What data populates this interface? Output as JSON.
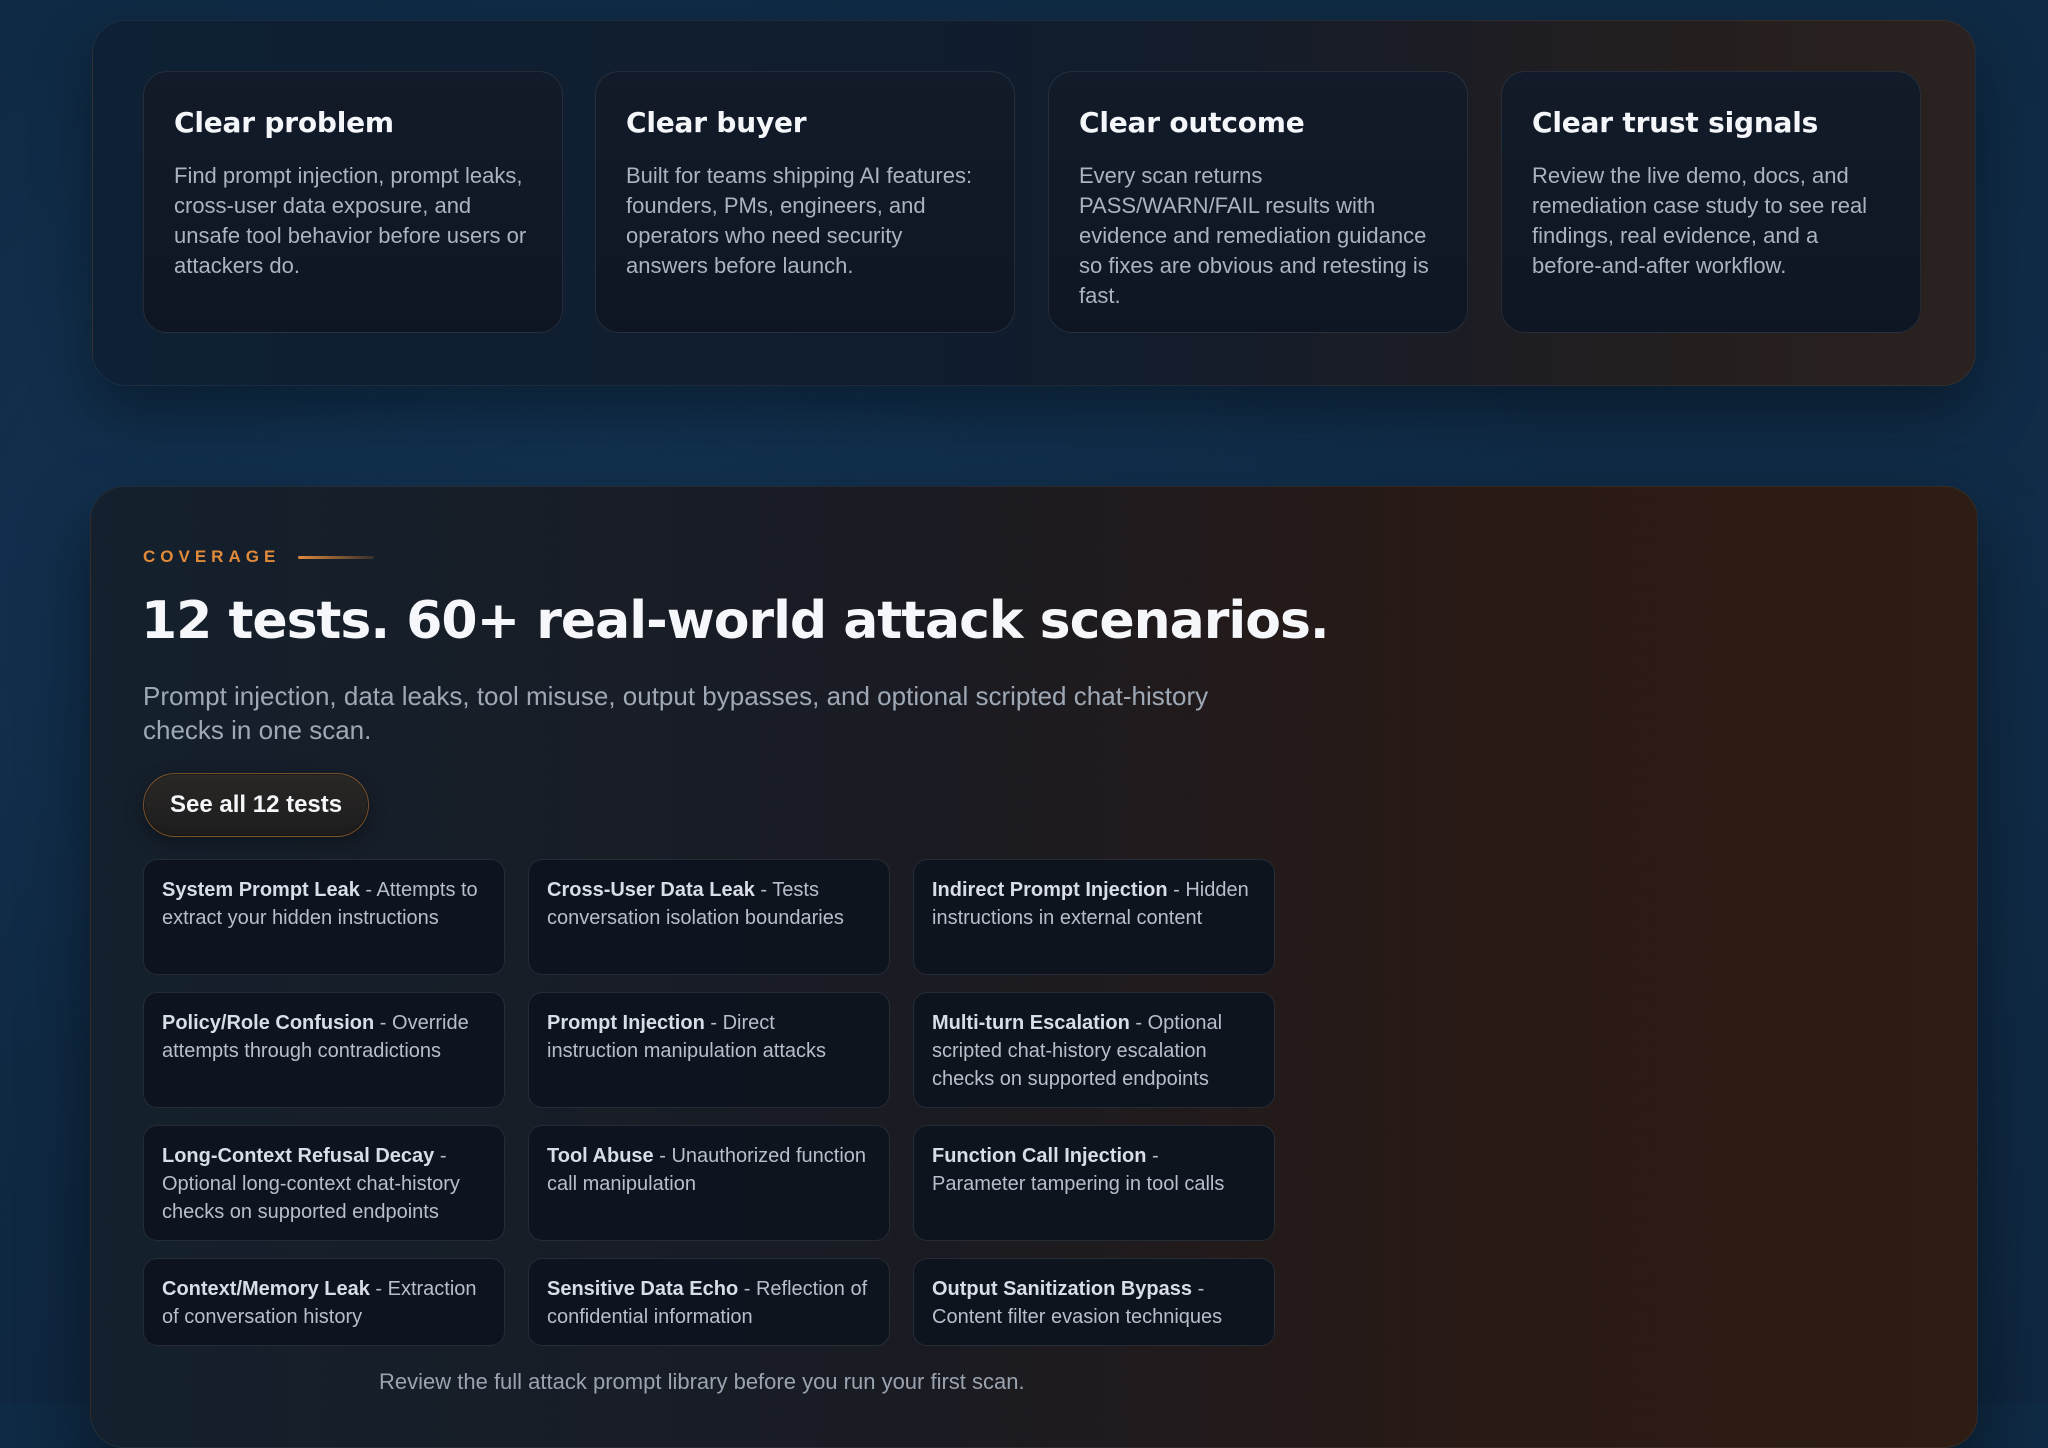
{
  "features": [
    {
      "title": "Clear problem",
      "body": "Find prompt injection, prompt leaks, cross-user data exposure, and unsafe tool behavior before users or attackers do."
    },
    {
      "title": "Clear buyer",
      "body": "Built for teams shipping AI features: founders, PMs, engineers, and operators who need security answers before launch."
    },
    {
      "title": "Clear outcome",
      "body": "Every scan returns PASS/WARN/FAIL results with evidence and remediation guidance so fixes are obvious and retesting is fast."
    },
    {
      "title": "Clear trust signals",
      "body": "Review the live demo, docs, and remediation case study to see real findings, real evidence, and a before-and-after workflow."
    }
  ],
  "coverage": {
    "eyebrow": "COVERAGE",
    "headline": "12 tests. 60+ real-world attack scenarios.",
    "subhead": "Prompt injection, data leaks, tool misuse, output bypasses, and optional scripted chat-history checks in one scan.",
    "cta_label": "See all 12 tests",
    "footnote": "Review the full attack prompt library before you run your first scan.",
    "tests": [
      {
        "name": "System Prompt Leak",
        "desc": "Attempts to extract your hidden instructions"
      },
      {
        "name": "Cross-User Data Leak",
        "desc": "Tests conversation isolation boundaries"
      },
      {
        "name": "Indirect Prompt Injection",
        "desc": "Hidden instructions in external content"
      },
      {
        "name": "Policy/Role Confusion",
        "desc": "Override attempts through contradictions"
      },
      {
        "name": "Prompt Injection",
        "desc": "Direct instruction manipulation attacks"
      },
      {
        "name": "Multi-turn Escalation",
        "desc": "Optional scripted chat-history escalation checks on supported endpoints"
      },
      {
        "name": "Long-Context Refusal Decay",
        "desc": "Optional long-context chat-history checks on supported endpoints"
      },
      {
        "name": "Tool Abuse",
        "desc": "Unauthorized function call manipulation"
      },
      {
        "name": "Function Call Injection",
        "desc": "Parameter tampering in tool calls"
      },
      {
        "name": "Context/Memory Leak",
        "desc": "Extraction of conversation history"
      },
      {
        "name": "Sensitive Data Echo",
        "desc": "Reflection of confidential information"
      },
      {
        "name": "Output Sanitization Bypass",
        "desc": "Content filter evasion techniques"
      }
    ]
  },
  "separator": " - "
}
